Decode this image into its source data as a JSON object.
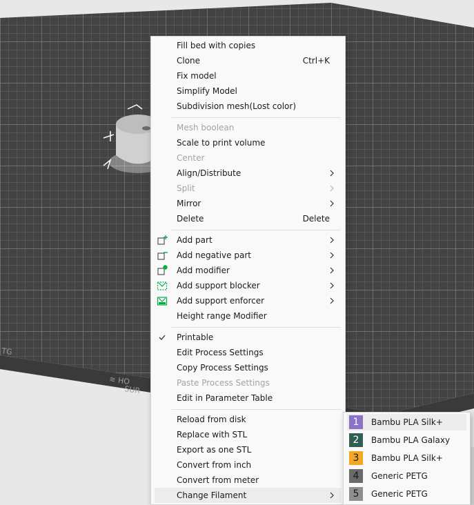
{
  "menu": {
    "items": [
      {
        "label": "Fill bed with copies"
      },
      {
        "label": "Clone",
        "shortcut": "Ctrl+K"
      },
      {
        "label": "Fix model"
      },
      {
        "label": "Simplify Model"
      },
      {
        "label": "Subdivision mesh(Lost color)"
      },
      {
        "label": "Mesh boolean",
        "disabled": true
      },
      {
        "label": "Scale to print volume"
      },
      {
        "label": "Center",
        "disabled": true
      },
      {
        "label": "Align/Distribute",
        "submenu": true
      },
      {
        "label": "Split",
        "disabled": true,
        "submenu": true
      },
      {
        "label": "Mirror",
        "submenu": true
      },
      {
        "label": "Delete",
        "shortcut": "Delete"
      },
      {
        "label": "Add part",
        "submenu": true,
        "icon": "add-part-icon"
      },
      {
        "label": "Add negative part",
        "submenu": true,
        "icon": "add-negative-part-icon"
      },
      {
        "label": "Add modifier",
        "submenu": true,
        "icon": "add-modifier-icon"
      },
      {
        "label": "Add support blocker",
        "submenu": true,
        "icon": "support-blocker-icon"
      },
      {
        "label": "Add support enforcer",
        "submenu": true,
        "icon": "support-enforcer-icon"
      },
      {
        "label": "Height range Modifier"
      },
      {
        "label": "Printable",
        "checked": true
      },
      {
        "label": "Edit Process Settings"
      },
      {
        "label": "Copy Process Settings"
      },
      {
        "label": "Paste Process Settings",
        "disabled": true
      },
      {
        "label": "Edit in Parameter Table"
      },
      {
        "label": "Reload from disk"
      },
      {
        "label": "Replace with STL"
      },
      {
        "label": "Export as one STL"
      },
      {
        "label": "Convert from inch"
      },
      {
        "label": "Convert from meter"
      },
      {
        "label": "Change Filament",
        "submenu": true,
        "highlighted": true
      }
    ]
  },
  "filaments": [
    {
      "index": "1",
      "name": "Bambu PLA Silk+",
      "color": "#8c72c4",
      "text_color": "#ffffff",
      "highlighted": true
    },
    {
      "index": "2",
      "name": "Bambu PLA Galaxy",
      "color": "#2f5f52",
      "text_color": "#ffffff"
    },
    {
      "index": "3",
      "name": "Bambu PLA Silk+",
      "color": "#f3a623",
      "text_color": "#1a1a1a"
    },
    {
      "index": "4",
      "name": "Generic PETG",
      "color": "#6a6a6a",
      "text_color": "#1a1a1a"
    },
    {
      "index": "5",
      "name": "Generic PETG",
      "color": "#8f8f8f",
      "text_color": "#1a1a1a"
    }
  ],
  "icons": {
    "checkmark": "check-icon",
    "submenu_arrow": "chevron-right-icon"
  },
  "colors": {
    "bed": "#434343",
    "accent_green": "#00ae42"
  }
}
